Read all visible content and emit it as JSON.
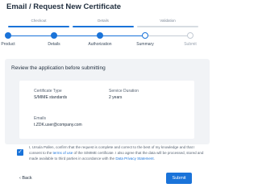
{
  "page": {
    "title": "Email / Request New Certificate"
  },
  "segments": [
    {
      "label": "Checkout",
      "color": "#1a73d9"
    },
    {
      "label": "Details",
      "color": "#1a73d9"
    },
    {
      "label": "Validation",
      "color": "#d7dce2"
    }
  ],
  "stepper": {
    "steps": [
      {
        "label": "Product",
        "state": "done"
      },
      {
        "label": "Details",
        "state": "done"
      },
      {
        "label": "Authorization",
        "state": "done"
      },
      {
        "label": "Summary",
        "state": "current"
      },
      {
        "label": "Submit",
        "state": "future"
      }
    ],
    "active_color": "#1a73d9",
    "inactive_color": "#c4cbd4"
  },
  "review": {
    "heading": "Review the application before submitting",
    "certificate_type_label": "Certificate Type",
    "certificate_type_value": "S/MIME standards",
    "service_duration_label": "Service Duration",
    "service_duration_value": "2 years",
    "email_label": "Emails",
    "email_value": "t.ZDK.user@company.com"
  },
  "agreement": {
    "checked": true,
    "text_before": "I, Ursula Pallen, confirm that the request is complete and correct to the best of my knowledge and that I consent to the ",
    "link1": "terms of use",
    "text_middle": " of the S/MIME certificate. I also agree that the data will be processed, stored and made available to third parties in accordance with the ",
    "link2": "Data Privacy Statement",
    "text_after": "."
  },
  "actions": {
    "back_label": "Back",
    "submit_label": "Submit"
  }
}
